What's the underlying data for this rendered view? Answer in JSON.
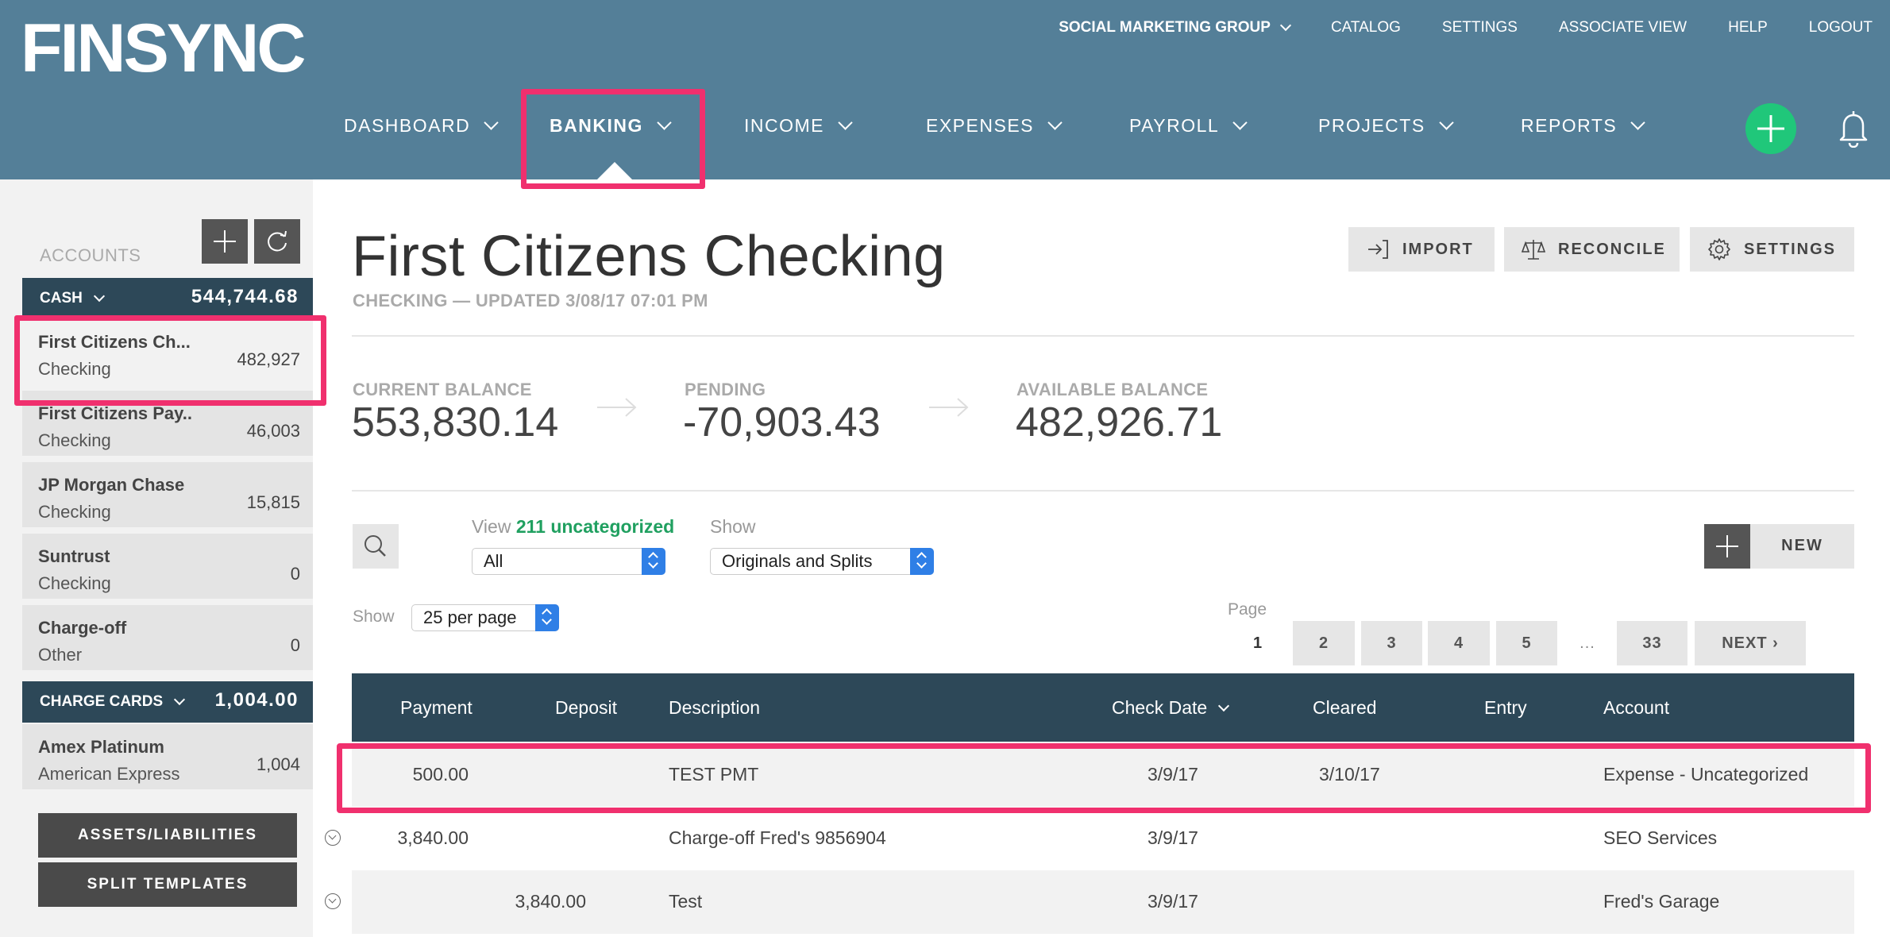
{
  "brand": {
    "logo_text": "FINSYNC",
    "accent": "#547f98",
    "dark": "#2d4858",
    "highlight": "#f0306e",
    "fab_color": "#20c77a"
  },
  "topnav": {
    "org": "SOCIAL MARKETING GROUP",
    "items": [
      "CATALOG",
      "SETTINGS",
      "ASSOCIATE VIEW",
      "HELP",
      "LOGOUT"
    ]
  },
  "mainnav": {
    "items": [
      "DASHBOARD",
      "BANKING",
      "INCOME",
      "EXPENSES",
      "PAYROLL",
      "PROJECTS",
      "REPORTS"
    ],
    "active": "BANKING"
  },
  "sidebar": {
    "title": "ACCOUNTS",
    "groups": [
      {
        "name": "CASH",
        "total": "544,744.68"
      },
      {
        "name": "CHARGE CARDS",
        "total": "1,004.00"
      }
    ],
    "accounts": [
      {
        "name": "First Citizens Ch...",
        "type": "Checking",
        "balance": "482,927"
      },
      {
        "name": "First Citizens Pay..",
        "type": "Checking",
        "balance": "46,003"
      },
      {
        "name": "JP Morgan Chase",
        "type": "Checking",
        "balance": "15,815"
      },
      {
        "name": "Suntrust",
        "type": "Checking",
        "balance": "0"
      },
      {
        "name": "Charge-off",
        "type": "Other",
        "balance": "0"
      },
      {
        "name": "Amex Platinum",
        "type": "American Express",
        "balance": "1,004"
      }
    ],
    "buttons": {
      "assets": "ASSETS/LIABILITIES",
      "templates": "SPLIT TEMPLATES"
    }
  },
  "main": {
    "title": "First Citizens Checking",
    "subtitle": "CHECKING — UPDATED 3/08/17 07:01 PM",
    "actions": {
      "import": "IMPORT",
      "reconcile": "RECONCILE",
      "settings": "SETTINGS"
    },
    "balances": {
      "current_label": "CURRENT BALANCE",
      "current": "553,830.14",
      "pending_label": "PENDING",
      "pending": "-70,903.43",
      "available_label": "AVAILABLE BALANCE",
      "available": "482,926.71"
    },
    "filters": {
      "view_prefix": "View ",
      "uncategorized": "211 uncategorized",
      "view_value": "All",
      "show_label": "Show",
      "show_value": "Originals and Splits",
      "perpage_label": "Show",
      "perpage_value": "25 per page"
    },
    "new_label": "NEW",
    "pagination": {
      "label": "Page",
      "pages": [
        "1",
        "2",
        "3",
        "4",
        "5",
        "...",
        "33"
      ],
      "next": "NEXT ›"
    },
    "table": {
      "headers": [
        "Payment",
        "Deposit",
        "Description",
        "Check Date",
        "Cleared",
        "Entry",
        "Account"
      ],
      "rows": [
        {
          "payment": "500.00",
          "deposit": "",
          "description": "TEST PMT",
          "check_date": "3/9/17",
          "cleared": "3/10/17",
          "entry": "",
          "account": "Expense - Uncategorized"
        },
        {
          "payment": "3,840.00",
          "deposit": "",
          "description": "Charge-off Fred's 9856904",
          "check_date": "3/9/17",
          "cleared": "",
          "entry": "",
          "account": "SEO Services"
        },
        {
          "payment": "",
          "deposit": "3,840.00",
          "description": "Test",
          "check_date": "3/9/17",
          "cleared": "",
          "entry": "",
          "account": "Fred's Garage"
        }
      ]
    }
  }
}
